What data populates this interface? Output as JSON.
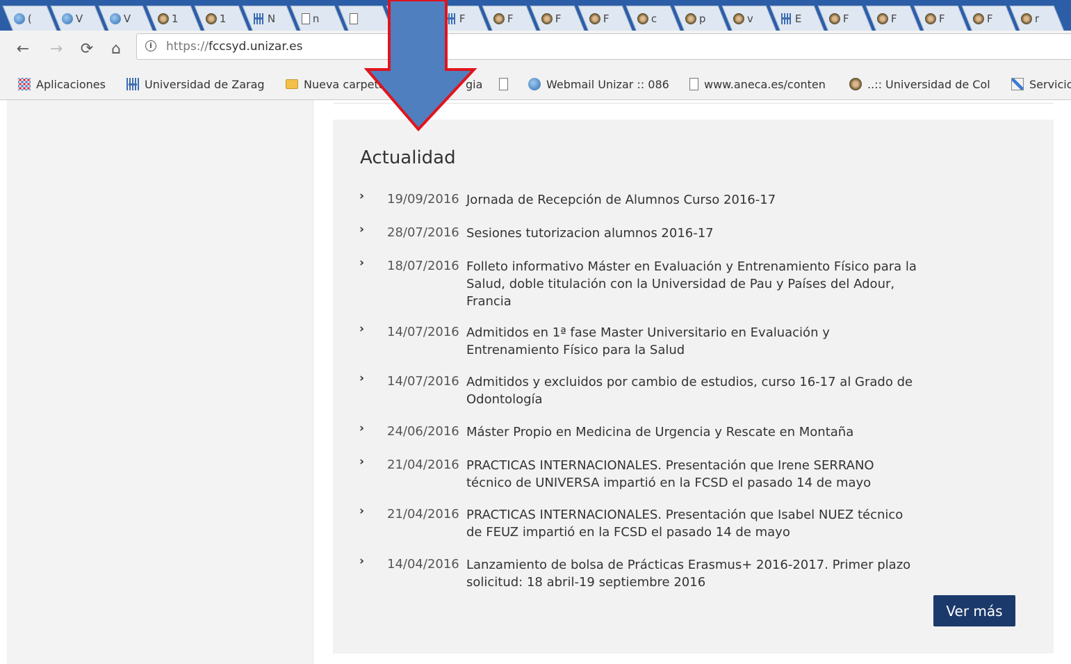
{
  "browser": {
    "tabs": [
      {
        "icon": "bird",
        "label": "("
      },
      {
        "icon": "bird",
        "label": "V"
      },
      {
        "icon": "bird",
        "label": "V"
      },
      {
        "icon": "seal",
        "label": "1"
      },
      {
        "icon": "seal",
        "label": "1"
      },
      {
        "icon": "uni",
        "label": "N"
      },
      {
        "icon": "doc",
        "label": "n"
      },
      {
        "icon": "doc",
        "label": ""
      },
      {
        "icon": "uni",
        "label": ""
      },
      {
        "icon": "uni",
        "label": "F"
      },
      {
        "icon": "seal",
        "label": "F"
      },
      {
        "icon": "seal",
        "label": "F"
      },
      {
        "icon": "seal",
        "label": "F"
      },
      {
        "icon": "seal",
        "label": "c"
      },
      {
        "icon": "seal",
        "label": "p"
      },
      {
        "icon": "seal",
        "label": "v"
      },
      {
        "icon": "uni",
        "label": "E"
      },
      {
        "icon": "seal",
        "label": "F"
      },
      {
        "icon": "seal",
        "label": "F"
      },
      {
        "icon": "seal",
        "label": "F"
      },
      {
        "icon": "seal",
        "label": "F"
      },
      {
        "icon": "seal",
        "label": "r"
      }
    ],
    "url_scheme": "https://",
    "url_host": "fccsyd.unizar.es",
    "bookmarks": [
      {
        "icon": "apps",
        "label": "Aplicaciones"
      },
      {
        "icon": "uni",
        "label": "Universidad de Zarag"
      },
      {
        "icon": "folder",
        "label": "Nueva carpeta"
      },
      {
        "icon": "none",
        "label": "gia"
      },
      {
        "icon": "doc",
        "label": ""
      },
      {
        "icon": "bird",
        "label": "Webmail Unizar :: 086"
      },
      {
        "icon": "doc",
        "label": "www.aneca.es/conten"
      },
      {
        "icon": "seal",
        "label": "..:: Universidad de Col"
      },
      {
        "icon": "pen",
        "label": "Servicio"
      }
    ]
  },
  "news": {
    "heading": "Actualidad",
    "items": [
      {
        "date": "19/09/2016",
        "title": "Jornada de Recepción de Alumnos Curso 2016-17"
      },
      {
        "date": "28/07/2016",
        "title": "Sesiones tutorizacion alumnos 2016-17"
      },
      {
        "date": "18/07/2016",
        "title": "Folleto informativo Máster en Evaluación y Entrenamiento Físico para la Salud, doble titulación con la Universidad de Pau y Países del Adour, Francia"
      },
      {
        "date": "14/07/2016",
        "title": "Admitidos en 1ª fase Master Universitario en Evaluación y Entrenamiento Físico para la Salud"
      },
      {
        "date": "14/07/2016",
        "title": "Admitidos y excluidos por cambio de estudios, curso 16-17 al Grado de Odontología"
      },
      {
        "date": "24/06/2016",
        "title": "Máster Propio en Medicina de Urgencia y Rescate en Montaña"
      },
      {
        "date": "21/04/2016",
        "title": "PRACTICAS INTERNACIONALES. Presentación que Irene SERRANO técnico de UNIVERSA impartió en la FCSD el pasado 14 de mayo"
      },
      {
        "date": "21/04/2016",
        "title": "PRACTICAS INTERNACIONALES. Presentación que Isabel NUEZ técnico de FEUZ impartió en la FCSD el pasado 14 de mayo"
      },
      {
        "date": "14/04/2016",
        "title": "Lanzamiento de bolsa de Prácticas Erasmus+ 2016-2017. Primer plazo solicitud: 18 abril-19 septiembre 2016"
      }
    ],
    "more_label": "Ver más"
  },
  "colors": {
    "tabstrip": "#2c5ea8",
    "button": "#1b3a6b",
    "arrow_fill": "#4f7fbf",
    "arrow_stroke": "#e0141e"
  }
}
